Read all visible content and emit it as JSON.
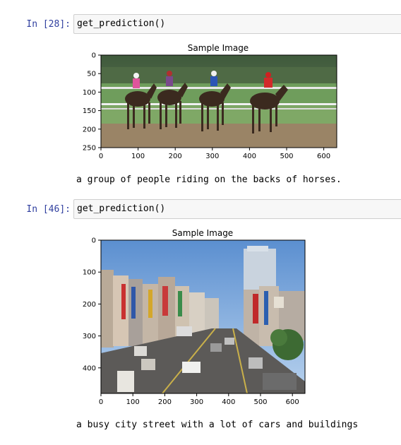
{
  "cells": [
    {
      "prompt": "In [28]:",
      "code": "get_prediction()",
      "figure": {
        "title": "Sample Image",
        "xticks": [
          "0",
          "100",
          "200",
          "300",
          "400",
          "500",
          "600"
        ],
        "yticks": [
          "0",
          "50",
          "100",
          "150",
          "200",
          "250"
        ]
      },
      "caption": "a group of people riding on the backs of horses."
    },
    {
      "prompt": "In [46]:",
      "code": "get_prediction()",
      "figure": {
        "title": "Sample Image",
        "xticks": [
          "0",
          "100",
          "200",
          "300",
          "400",
          "500",
          "600"
        ],
        "yticks": [
          "0",
          "100",
          "200",
          "300",
          "400"
        ]
      },
      "caption": "a busy city street with a lot of cars and buildings"
    }
  ]
}
